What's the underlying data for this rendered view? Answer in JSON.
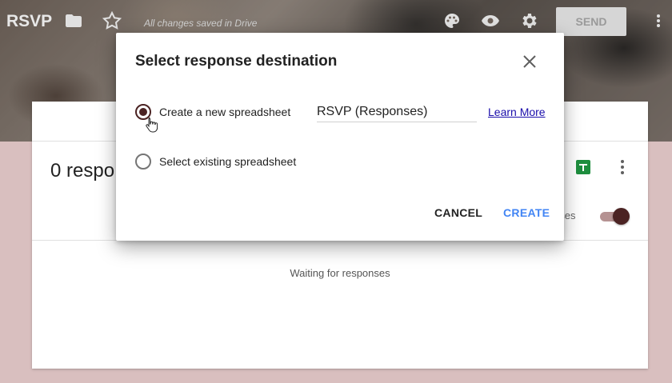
{
  "app": {
    "title": "RSVP",
    "saved_status": "All changes saved in Drive",
    "send_label": "SEND"
  },
  "icons": {
    "folder": "folder-icon",
    "star": "star-icon",
    "palette": "palette-icon",
    "preview": "eye-icon",
    "settings": "gear-icon",
    "more": "more-vert-icon"
  },
  "card": {
    "response_count": "0 respo",
    "accepting_label": "nses",
    "waiting_text": "Waiting for responses"
  },
  "dialog": {
    "title": "Select response destination",
    "option_new": "Create a new spreadsheet",
    "option_existing": "Select existing spreadsheet",
    "spreadsheet_name": "RSVP (Responses)",
    "learn_more": "Learn More",
    "cancel_label": "CANCEL",
    "create_label": "CREATE",
    "selected_option": "new"
  },
  "colors": {
    "accent": "#4b2323",
    "link_blue": "#1a0dab",
    "create_blue": "#4285f4",
    "page_bg": "#d9bfbf"
  }
}
